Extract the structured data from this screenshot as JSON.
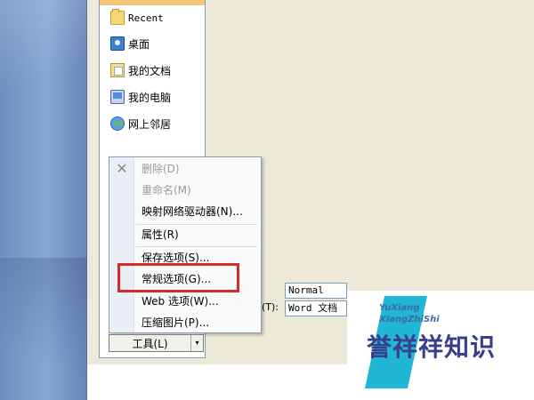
{
  "places": [
    {
      "label": "Recent",
      "icon": "folder-icon"
    },
    {
      "label": "桌面",
      "icon": "desktop-icon"
    },
    {
      "label": "我的文档",
      "icon": "my-documents-icon"
    },
    {
      "label": "我的电脑",
      "icon": "my-computer-icon"
    },
    {
      "label": "网上邻居",
      "icon": "network-icon"
    }
  ],
  "context_menu": {
    "items": [
      {
        "label": "删除(D)",
        "enabled": false
      },
      {
        "label": "重命名(M)",
        "enabled": false
      },
      {
        "label": "映射网络驱动器(N)...",
        "enabled": true
      },
      {
        "label": "属性(R)",
        "enabled": true
      },
      {
        "label": "保存选项(S)...",
        "enabled": true
      },
      {
        "label": "常规选项(G)...",
        "enabled": true,
        "highlighted": true
      },
      {
        "label": "Web 选项(W)...",
        "enabled": true
      },
      {
        "label": "压缩图片(P)...",
        "enabled": true
      }
    ]
  },
  "fields": {
    "file_name_value": "Normal",
    "file_type_label": "(T):",
    "file_type_value": "Word 文档"
  },
  "tools_button": {
    "label": "工具(L)",
    "arrow": "▾"
  },
  "watermark": {
    "en_line1": "YuXiang",
    "en_line2": "XiangZhiShi",
    "cn": "誉祥祥知识"
  },
  "colors": {
    "highlight": "#d72a2a",
    "places_selected": "#f5c77a"
  }
}
